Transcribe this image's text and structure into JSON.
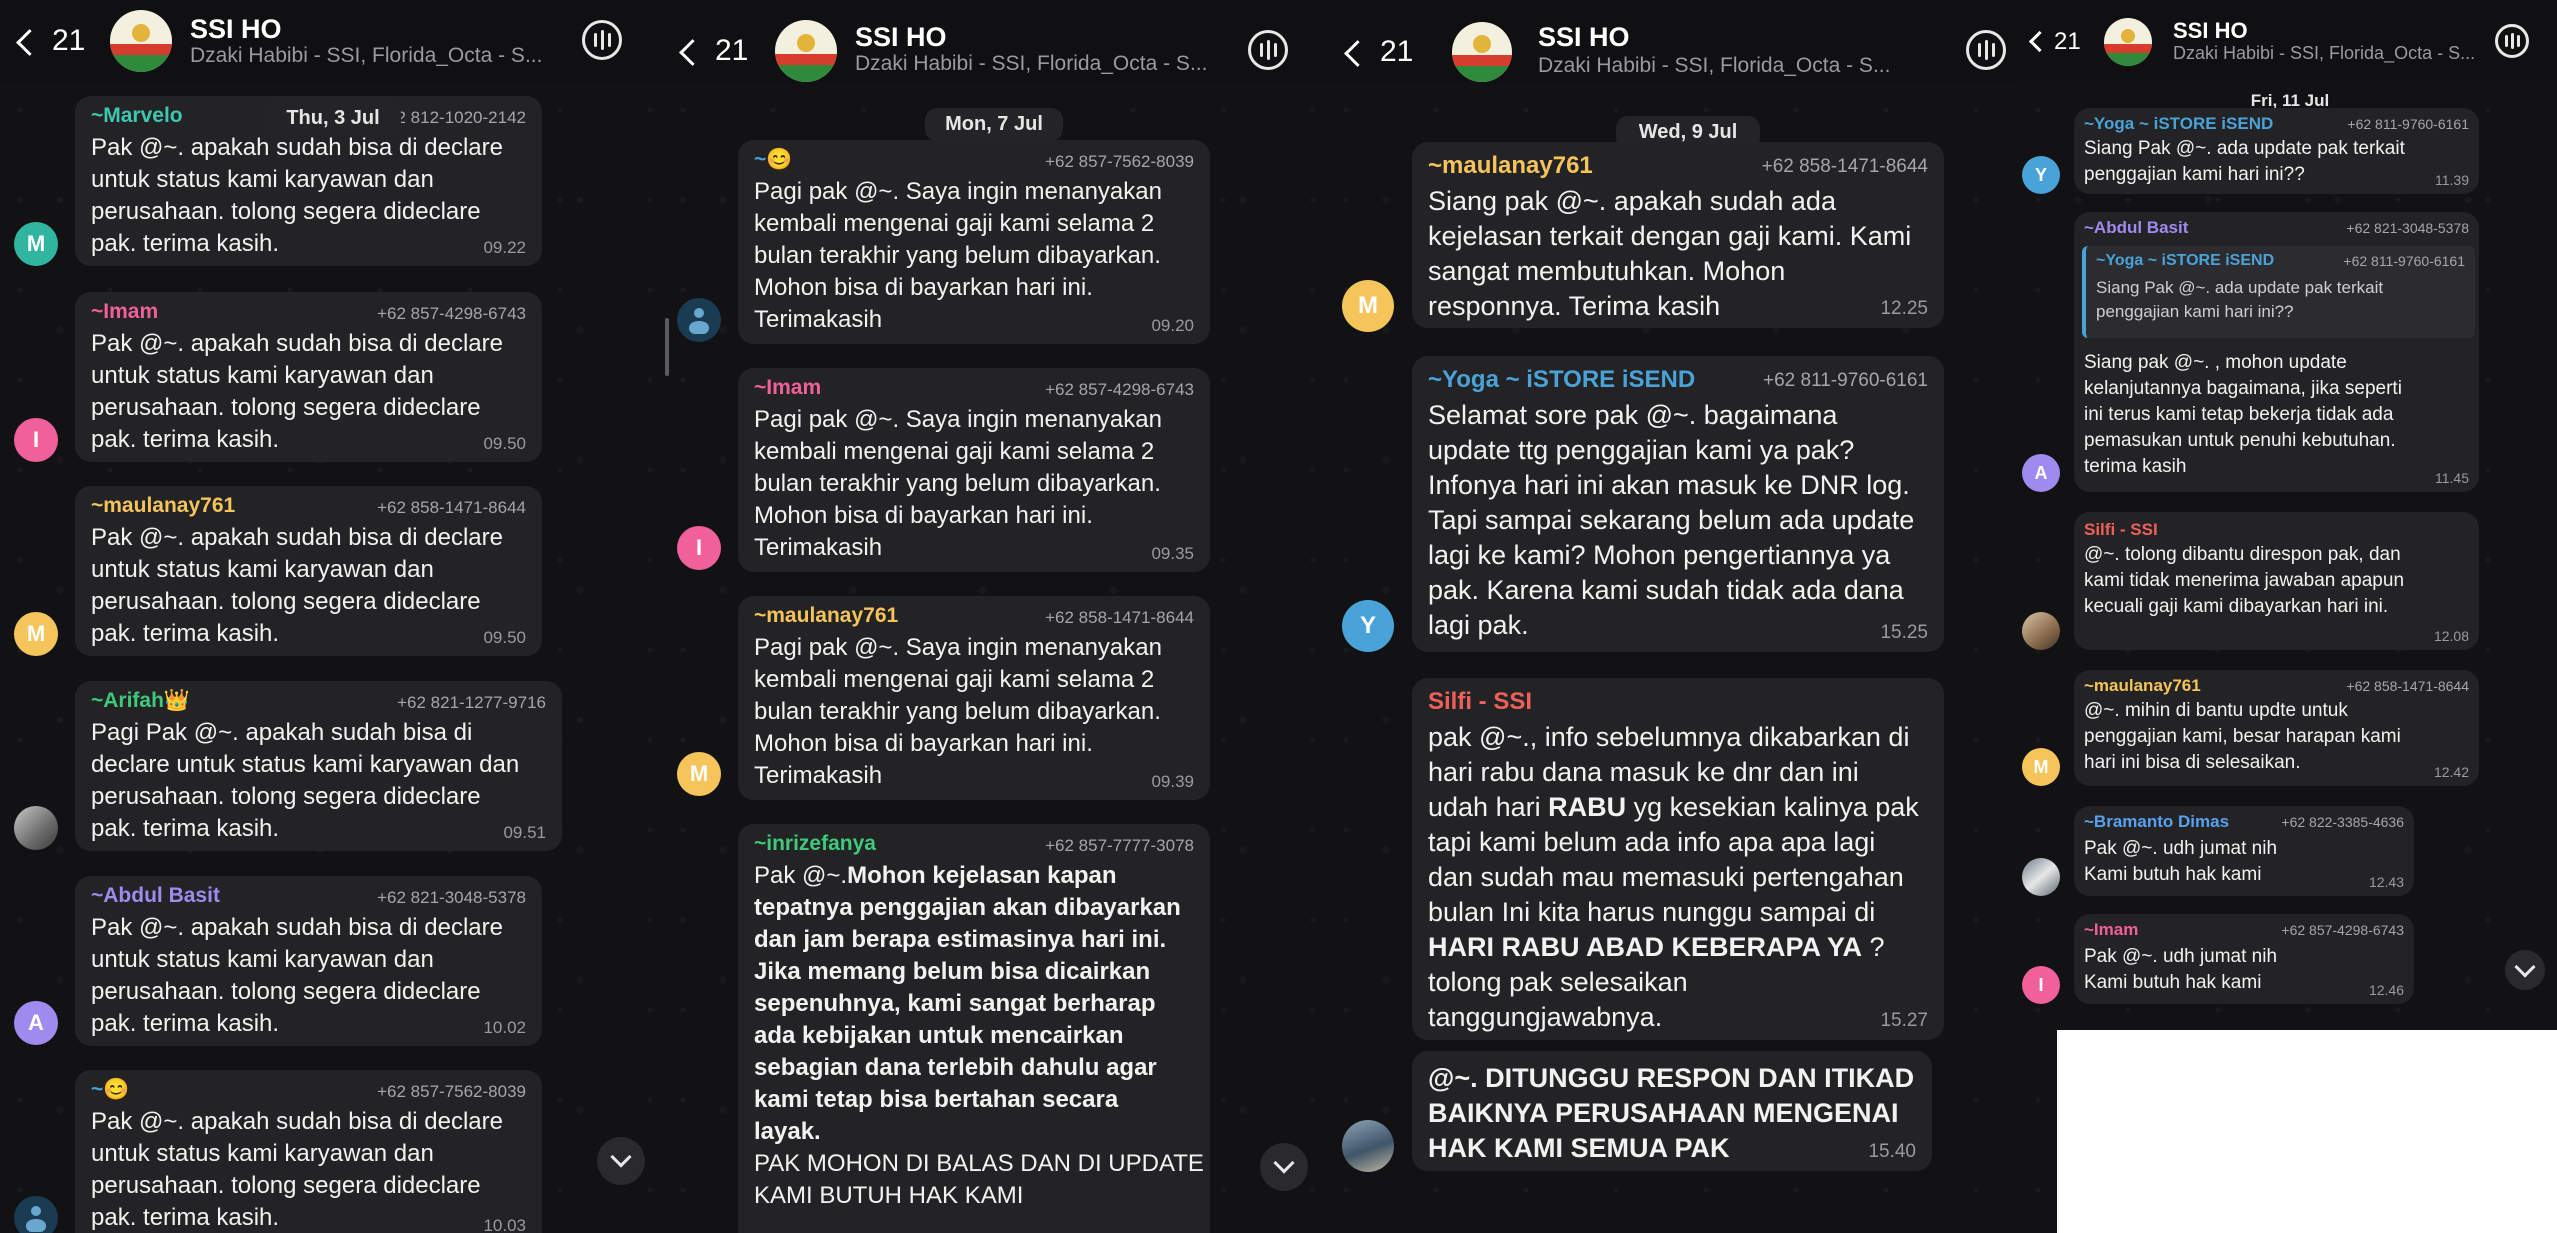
{
  "header": {
    "back_count": "21",
    "title": "SSI HO",
    "subtitle": "Dzaki Habibi - SSI, Florida_Octa - S..."
  },
  "colors": {
    "background": "#121214",
    "bubble": "#232325",
    "marvelo": "#3ec7b0",
    "imam": "#f0609a",
    "maulanay": "#f5c45a",
    "arifah": "#3fc97b",
    "abdul": "#9f8bf0",
    "smiley": "#4aa3d8",
    "yoga": "#4aa3d8",
    "silfi": "#f0605a",
    "inrize": "#3fc97b",
    "bramanto": "#5aa0f0"
  },
  "panel1": {
    "date": "Thu, 3 Jul",
    "messages": [
      {
        "sender": "~Marvelo",
        "phone": "+62 812-1020-2142",
        "text": "Pak @~. apakah sudah bisa di declare\nuntuk status kami karyawan dan\nperusahaan. tolong segera dideclare\npak. terima kasih.",
        "time": "09.22",
        "avatar": "M"
      },
      {
        "sender": "~Imam",
        "phone": "+62 857-4298-6743",
        "text": "Pak @~. apakah sudah bisa di declare\nuntuk status kami karyawan dan\nperusahaan. tolong segera dideclare\npak. terima kasih.",
        "time": "09.50",
        "avatar": "I"
      },
      {
        "sender": "~maulanay761",
        "phone": "+62 858-1471-8644",
        "text": "Pak @~. apakah sudah bisa di declare\nuntuk status kami karyawan dan\nperusahaan. tolong segera dideclare\npak. terima kasih.",
        "time": "09.50",
        "avatar": "M"
      },
      {
        "sender": "~Arifah👑",
        "phone": "+62 821-1277-9716",
        "text": "Pagi Pak @~. apakah sudah bisa di\ndeclare untuk status kami karyawan dan\nperusahaan. tolong segera dideclare\npak. terima kasih.",
        "time": "09.51",
        "avatar": ""
      },
      {
        "sender": "~Abdul Basit",
        "phone": "+62 821-3048-5378",
        "text": "Pak @~. apakah sudah bisa di declare\nuntuk status kami karyawan dan\nperusahaan. tolong segera dideclare\npak. terima kasih.",
        "time": "10.02",
        "avatar": "A"
      },
      {
        "sender": "~😊",
        "phone": "+62 857-7562-8039",
        "text": "Pak @~. apakah sudah bisa di declare\nuntuk status kami karyawan dan\nperusahaan. tolong segera dideclare\npak. terima kasih.",
        "time": "10.03",
        "avatar": ""
      }
    ]
  },
  "panel2": {
    "date": "Mon, 7 Jul",
    "messages": [
      {
        "sender": "~😊",
        "phone": "+62 857-7562-8039",
        "text": "Pagi pak @~. Saya ingin menanyakan\nkembali mengenai gaji kami selama 2\nbulan terakhir yang belum dibayarkan.\nMohon bisa di bayarkan hari ini.\nTerimakasih",
        "time": "09.20",
        "avatar": ""
      },
      {
        "sender": "~Imam",
        "phone": "+62 857-4298-6743",
        "text": "Pagi pak @~. Saya ingin menanyakan\nkembali mengenai gaji kami selama 2\nbulan terakhir yang belum dibayarkan.\nMohon bisa di bayarkan hari ini.\nTerimakasih",
        "time": "09.35",
        "avatar": "I"
      },
      {
        "sender": "~maulanay761",
        "phone": "+62 858-1471-8644",
        "text": "Pagi pak @~. Saya ingin menanyakan\nkembali mengenai gaji kami selama 2\nbulan terakhir yang belum dibayarkan.\nMohon bisa di bayarkan hari ini.\nTerimakasih",
        "time": "09.39",
        "avatar": "M"
      },
      {
        "sender": "~inrizefanya",
        "phone": "+62 857-7777-3078",
        "text_lead": "Pak @~.",
        "text_bold": "Mohon kejelasan kapan\ntepatnya penggajian akan dibayarkan\ndan jam berapa estimasinya hari ini.\nJika memang belum bisa dicairkan\nsepenuhnya, kami sangat berharap\nada kebijakan untuk mencairkan\nsebagian dana terlebih dahulu agar\nkami tetap bisa bertahan secara\nlayak.",
        "text_tail": "PAK MOHON DI BALAS DAN DI UPDATE\nKAMI BUTUH HAK KAMI"
      }
    ]
  },
  "panel3": {
    "date": "Wed, 9 Jul",
    "messages": [
      {
        "sender": "~maulanay761",
        "phone": "+62 858-1471-8644",
        "text": "Siang pak @~. apakah sudah ada\nkejelasan terkait dengan gaji kami. Kami\nsangat membutuhkan. Mohon\nresponnya. Terima kasih",
        "time": "12.25",
        "avatar": "M"
      },
      {
        "sender": "~Yoga ~ iSTORE iSEND",
        "phone": "+62 811-9760-6161",
        "text": "Selamat sore pak @~. bagaimana\nupdate ttg penggajian kami ya pak?\nInfonya hari ini akan masuk ke DNR log.\nTapi sampai sekarang belum ada update\nlagi ke kami? Mohon pengertiannya ya\npak. Karena kami sudah tidak ada dana\nlagi pak.",
        "time": "15.25",
        "avatar": "Y"
      },
      {
        "sender": "Silfi - SSI",
        "text_a": "pak @~., info sebelumnya dikabarkan di\nhari rabu dana masuk ke dnr dan ini\nudah hari ",
        "text_b": "RABU",
        "text_c": " yg kesekian kalinya pak\ntapi kami belum ada info apa apa lagi\ndan sudah mau memasuki pertengahan\nbulan Ini kita harus nunggu sampai di\n",
        "text_d": "HARI RABU ABAD KEBERAPA YA",
        "text_e": " ?\ntolong pak selesaikan\ntanggungjawabnya.",
        "time": "15.27"
      },
      {
        "sender": "",
        "text": "@~. DITUNGGU RESPON DAN ITIKAD\nBAIKNYA PERUSAHAAN MENGENAI\nHAK KAMI SEMUA PAK",
        "time": "15.40"
      }
    ]
  },
  "panel4": {
    "date": "Fri, 11 Jul",
    "messages": [
      {
        "sender": "~Yoga ~ iSTORE iSEND",
        "phone": "+62 811-9760-6161",
        "text": "Siang Pak @~. ada update pak terkait\npenggajian kami hari ini??",
        "time": "11.39",
        "avatar": "Y"
      },
      {
        "sender": "~Abdul Basit",
        "phone": "+62 821-3048-5378",
        "quote_sender": "~Yoga ~ iSTORE iSEND",
        "quote_phone": "+62 811-9760-6161",
        "quote_text": "Siang Pak @~. ada update pak terkait\npenggajian kami hari ini??",
        "text": "Siang pak @~.  , mohon update\nkelanjutannya bagaimana, jika seperti\nini terus kami tetap bekerja tidak ada\npemasukan untuk penuhi kebutuhan.\nterima kasih",
        "time": "11.45",
        "avatar": "A"
      },
      {
        "sender": "Silfi - SSI",
        "text": "@~. tolong dibantu direspon pak, dan\nkami tidak menerima jawaban apapun\nkecuali gaji kami dibayarkan hari ini.",
        "time": "12.08"
      },
      {
        "sender": "~maulanay761",
        "phone": "+62 858-1471-8644",
        "text": "@~. mihin di bantu updte untuk\npenggajian kami, besar harapan kami\nhari ini bisa di selesaikan.",
        "time": "12.42",
        "avatar": "M"
      },
      {
        "sender": "~Bramanto Dimas",
        "phone": "+62 822-3385-4636",
        "text": "Pak @~. udh jumat nih\nKami butuh hak kami",
        "time": "12.43"
      },
      {
        "sender": "~Imam",
        "phone": "+62 857-4298-6743",
        "text": "Pak @~. udh jumat nih\nKami butuh hak kami",
        "time": "12.46",
        "avatar": "I"
      }
    ]
  }
}
